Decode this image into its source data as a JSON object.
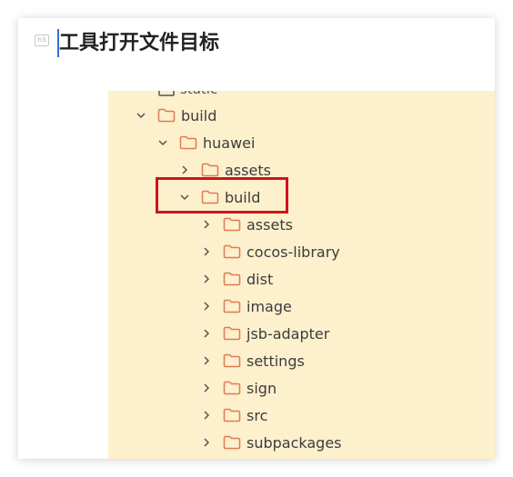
{
  "heading": {
    "badge": "h3",
    "title": "工具打开文件目标"
  },
  "tree": {
    "partial_top": "static",
    "items": [
      {
        "label": "build",
        "expanded": true
      },
      {
        "label": "huawei",
        "expanded": true
      },
      {
        "label": "assets",
        "expanded": false
      },
      {
        "label": "build",
        "expanded": true,
        "highlighted": true
      },
      {
        "label": "assets",
        "expanded": false
      },
      {
        "label": "cocos-library",
        "expanded": false
      },
      {
        "label": "dist",
        "expanded": false
      },
      {
        "label": "image",
        "expanded": false
      },
      {
        "label": "jsb-adapter",
        "expanded": false
      },
      {
        "label": "settings",
        "expanded": false
      },
      {
        "label": "sign",
        "expanded": false
      },
      {
        "label": "src",
        "expanded": false
      },
      {
        "label": "subpackages",
        "expanded": false
      }
    ]
  },
  "colors": {
    "panel_bg": "#fdf0cd",
    "folder_stroke": "#e07b53",
    "highlight": "#d0141c",
    "caret": "#2f6fd6"
  }
}
